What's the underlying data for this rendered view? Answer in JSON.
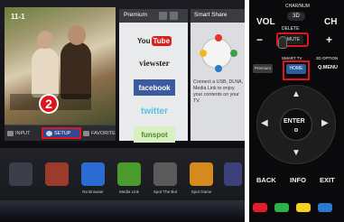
{
  "tv": {
    "channel": "11-1",
    "buttons": {
      "input": "INPUT",
      "setup": "SETUP",
      "favorite": "FAVORITE"
    },
    "step_number": "2",
    "premium": {
      "title": "Premium",
      "apps": [
        "You",
        "Tube",
        "viewster",
        "facebook",
        "twitter",
        "funspot"
      ]
    },
    "smart_share": {
      "title": "Smart Share",
      "description": "Connect a USB, DLNA, Media Link to enjoy your contents on your TV."
    },
    "dock": [
      "No Browser",
      "Media Link",
      "Spot The Bot",
      "Spot Game"
    ]
  },
  "remote": {
    "vol": "VOL",
    "ch": "CH",
    "char_num": "CHAR/NUM",
    "btn_3d": "3D",
    "delete": "DELETE",
    "mute": "MUTE",
    "minus": "−",
    "plus": "+",
    "smart_tv": "SMART TV",
    "three_d_option": "3D OPTION",
    "premium": "Premium",
    "home": "HOME",
    "q_menu": "Q.MENU",
    "enter": "ENTER",
    "back": "BACK",
    "info": "INFO",
    "exit": "EXIT",
    "color_keys": [
      "#e31b2b",
      "#2bb34a",
      "#f2d21b",
      "#2a78d0"
    ]
  }
}
